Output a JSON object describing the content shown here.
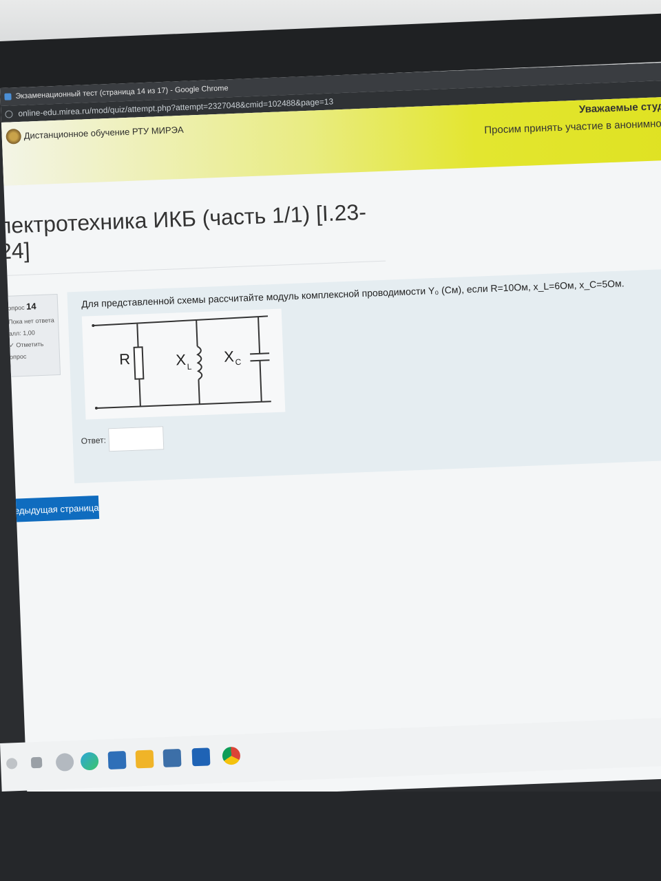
{
  "browser": {
    "window_title": "Экзаменационный тест (страница 14 из 17) - Google Chrome",
    "url": "online-edu.mirea.ru/mod/quiz/attempt.php?attempt=2327048&cmid=102488&page=13"
  },
  "site": {
    "name": "Дистанционное обучение РТУ МИРЭА",
    "notice_line1": "Уважаемые студен",
    "notice_line2": "Просим принять участие в анонимном с"
  },
  "course": {
    "title": "лектротехника ИКБ (часть 1/1) [I.23-24]"
  },
  "question_info": {
    "label": "опрос",
    "number": "14",
    "status": "Пока нет ответа",
    "score": "алл: 1,00",
    "flag": "Отметить",
    "flag2": "опрос"
  },
  "question": {
    "text": "Для представленной схемы рассчитайте модуль комплексной проводимости Y₀ (См), если R=10Ом, x_L=6Ом, x_C=5Ом.",
    "circuit_labels": {
      "r": "R",
      "xl": "X",
      "xl_sub": "L",
      "xc": "X",
      "xc_sub": "C"
    },
    "answer_label": "Ответ:",
    "answer_value": ""
  },
  "navigation": {
    "prev_label": "редыдущая страница"
  },
  "colors": {
    "accent": "#0f6cbf",
    "banner": "#e3e630"
  },
  "taskbar_icons": [
    "search-icon",
    "task-view-icon",
    "chat-icon",
    "edge-icon",
    "store-icon",
    "folder-icon",
    "calculator-icon",
    "mail-icon",
    "chrome-icon"
  ]
}
